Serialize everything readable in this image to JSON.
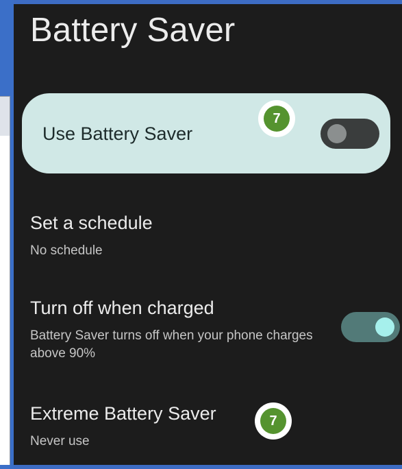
{
  "page_title": "Battery Saver",
  "primary_toggle": {
    "label": "Use Battery Saver",
    "state": "off"
  },
  "settings": [
    {
      "title": "Set a schedule",
      "subtitle": "No schedule"
    },
    {
      "title": "Turn off when charged",
      "subtitle": "Battery Saver turns off when your phone charges above 90%",
      "toggle_state": "on"
    },
    {
      "title": "Extreme Battery Saver",
      "subtitle": "Never use"
    }
  ],
  "badges": [
    {
      "value": "7",
      "color": "#55932f"
    },
    {
      "value": "7",
      "color": "#55932f"
    }
  ],
  "colors": {
    "screen_bg": "#1c1c1c",
    "card_bg": "#d0e8e6",
    "toggle_on_track": "#527a78",
    "toggle_on_thumb": "#a6f0ec",
    "toggle_off_track": "#3a3d3d",
    "frame": "#3d6cc4"
  }
}
